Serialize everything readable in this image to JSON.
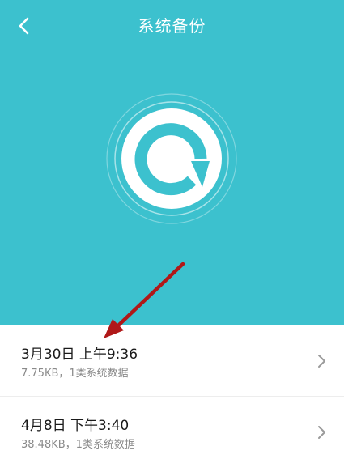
{
  "header": {
    "title": "系统备份"
  },
  "icons": {
    "back": "chevron-left-icon",
    "backup_logo": "backup-refresh-icon",
    "item_chevron": "chevron-right-icon",
    "annotation": "red-arrow-annotation"
  },
  "colors": {
    "header_background": "#3cc1ce",
    "title_text": "#ffffff",
    "item_title": "#1a1a1a",
    "item_subtitle": "#8a8a8a",
    "annotation_arrow": "#b01818"
  },
  "backups": [
    {
      "title": "3月30日 上午9:36",
      "subtitle": "7.75KB，1类系统数据"
    },
    {
      "title": "4月8日 下午3:40",
      "subtitle": "38.48KB，1类系统数据"
    }
  ]
}
